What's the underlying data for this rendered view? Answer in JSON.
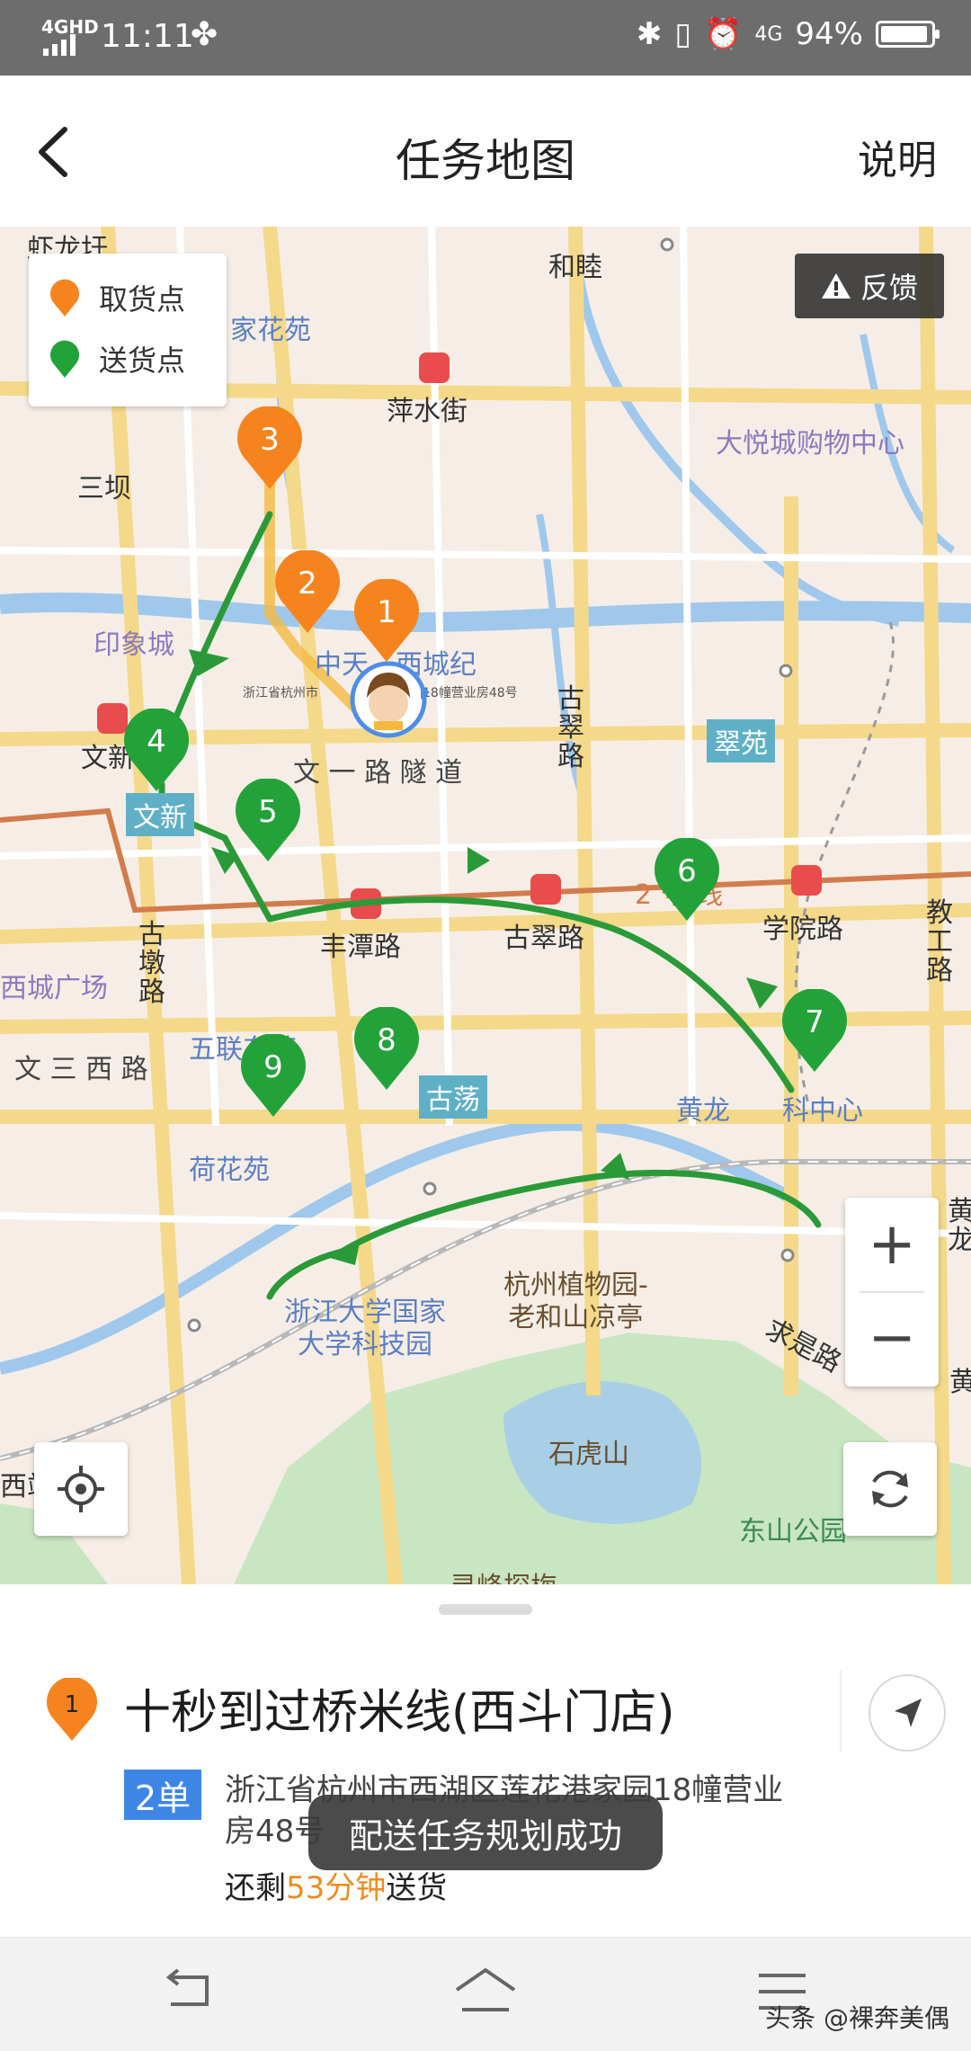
{
  "status_bar": {
    "network": "4GHD",
    "time": "11:11",
    "network_right": "4G",
    "battery": "94%",
    "battery_level": 0.94
  },
  "header": {
    "title": "任务地图",
    "help_label": "说明"
  },
  "map": {
    "legend": {
      "pickup": "取货点",
      "delivery": "送货点"
    },
    "feedback_label": "反馈",
    "pickup_color": "#f5841f",
    "delivery_color": "#23a23a",
    "route_color": "#2a9a38",
    "markers": {
      "m1": "1",
      "m2": "2",
      "m3": "3",
      "m4": "4",
      "m5": "5",
      "m6": "6",
      "m7": "7",
      "m8": "8",
      "m9": "9"
    },
    "rider_address": "浙江省杭州市",
    "rider_address_right": "18幢营业房48号",
    "labels": {
      "xialongwei": "虾龙圩",
      "hemu": "和睦",
      "jiahuayuan": "家花苑",
      "pingshuijie": "萍水街",
      "dayuecheng": "大悦城购物中心",
      "sanba": "三坝",
      "yinxiangcheng": "印象城",
      "zhongtian": "中天",
      "xichengji": "西城纪",
      "gucuilu": "古\n翠\n路",
      "cuiyuan": "翠苑",
      "wenxin_metro": "文新",
      "wenyilu": "文 一 路 隧 道",
      "wenxin_box": "文新",
      "line2": "2 号 线",
      "xueyuanlu": "学院路",
      "jiaogonglu": "教\n工\n路",
      "fengtanlu": "丰潭路",
      "gucui_metro": "古翠路",
      "xichengguangchang": "西城广场",
      "gudunlu": "古\n墩\n路",
      "wusanxilu": "文 三 西 路",
      "wulian": "五联东苑",
      "huanglong": "黄龙",
      "keji": "科中心",
      "gudang": "古荡",
      "hehuayuan": "荷花苑",
      "zjdx_keji": "浙江大学国家\n大学科技园",
      "zhiwuyuan": "杭州植物园-\n老和山凉亭",
      "qiushi": "求是路",
      "shihushan": "石虎山",
      "dongshan": "东山公园",
      "lingfeng": "灵峰探梅",
      "xidou": "西站",
      "huanglong_r": "黄\n龙",
      "huang_r2": "黄"
    }
  },
  "panel": {
    "index": "1",
    "shop_name": "十秒到过桥米线(西斗门店)",
    "order_badge": "2单",
    "address": "浙江省杭州市西湖区莲花港家园18幢营业房48号",
    "remain_prefix": "还剩",
    "remain_time": "53分钟",
    "remain_suffix": "送货",
    "toast": "配送任务规划成功"
  },
  "watermark": "头条 @裸奔美偶"
}
